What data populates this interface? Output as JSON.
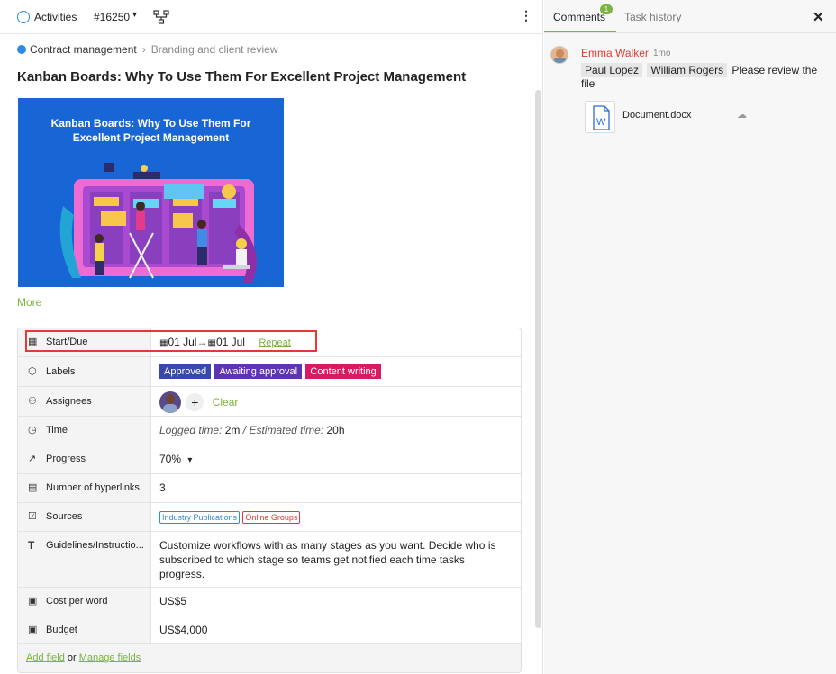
{
  "header": {
    "status_label": "Activities",
    "task_id": "#16250",
    "colors": {
      "accent": "#7cb342",
      "status_blue": "#2d8be0",
      "highlight": "#e53935"
    }
  },
  "breadcrumb": {
    "parent": "Contract management",
    "current": "Branding and client review"
  },
  "task": {
    "title": "Kanban Boards: Why To Use Them For Excellent Project Management",
    "cover_text_line1": "Kanban Boards: Why To Use Them For",
    "cover_text_line2": "Excellent Project Management",
    "more_label": "More"
  },
  "fields": {
    "start_due": {
      "label": "Start/Due",
      "start": "01 Jul",
      "arrow": "→",
      "due": "01 Jul",
      "repeat": "Repeat"
    },
    "labels": {
      "label": "Labels",
      "items": [
        "Approved",
        "Awaiting approval",
        "Content writing"
      ]
    },
    "assignees": {
      "label": "Assignees",
      "add": "+",
      "clear": "Clear"
    },
    "time": {
      "label": "Time",
      "logged_label": "Logged time:",
      "logged_value": "2m",
      "slash": "/",
      "estimated_label": "Estimated time:",
      "estimated_value": "20h"
    },
    "progress": {
      "label": "Progress",
      "value": "70%"
    },
    "hyperlinks": {
      "label": "Number of hyperlinks",
      "value": "3"
    },
    "sources": {
      "label": "Sources",
      "items": [
        "Industry Publications",
        "Online Groups"
      ]
    },
    "guidelines": {
      "label": "Guidelines/Instructio...",
      "value": "Customize workflows with as many stages as you want. Decide who is subscribed to which stage so teams get notified each time tasks progress."
    },
    "cost_per_word": {
      "label": "Cost per word",
      "value": "US$5"
    },
    "budget": {
      "label": "Budget",
      "value": "US$4,000"
    },
    "footer": {
      "add_field": "Add field",
      "or": "or",
      "manage_fields": "Manage fields"
    }
  },
  "sidebar": {
    "tabs": {
      "comments": "Comments",
      "comments_count": "1",
      "history": "Task history"
    },
    "comment": {
      "author": "Emma Walker",
      "time": "1mo",
      "mention1": "Paul Lopez",
      "mention2": "William Rogers",
      "text": "Please review the file",
      "attachment": "Document.docx"
    }
  }
}
